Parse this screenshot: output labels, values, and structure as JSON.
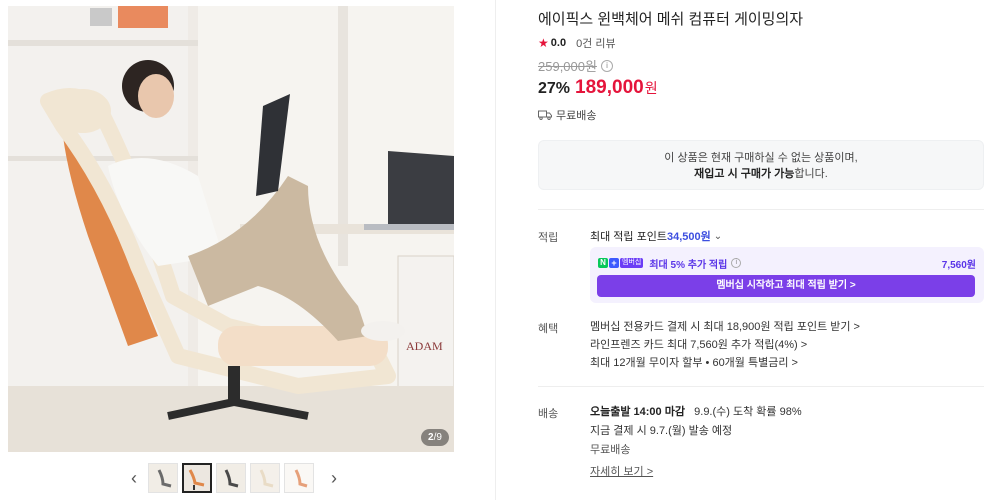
{
  "gallery": {
    "counter_current": "2",
    "counter_total": "/9",
    "prev_arrow": "‹",
    "next_arrow": "›"
  },
  "product": {
    "title": "에이픽스 윈백체어 메쉬 컴퓨터 게이밍의자",
    "rating": "0.0",
    "review_count": "0건 리뷰",
    "original_price": "259,000원",
    "discount": "27%",
    "price": "189,000",
    "price_unit": "원",
    "free_shipping": "무료배송"
  },
  "notice": {
    "line1": "이 상품은 현재 구매하실 수 없는 상품이며,",
    "line2_strong": "재입고 시 구매가 가능",
    "line2_rest": "합니다."
  },
  "points": {
    "label": "적립",
    "link_prefix": "최대 적립 포인트 ",
    "link_amount": "34,500원",
    "badge_n": "N",
    "badge_plus": "+",
    "badge_membership": "멤버십",
    "member_text": "최대 5% 추가 적립",
    "member_amount": "7,560원",
    "member_button": "멤버십 시작하고 최대 적립 받기 >"
  },
  "benefits": {
    "label": "혜택",
    "items": [
      "멤버십 전용카드 결제 시 최대 18,900원 적립 포인트 받기 >",
      "라인프렌즈 카드 최대 7,560원 추가 적립(4%) >",
      "최대 12개월 무이자 할부 • 60개월 특별금리 >"
    ]
  },
  "delivery": {
    "label": "배송",
    "cutoff": "오늘출발 14:00 마감",
    "arrival": "9.9.(수) 도착 확률 98%",
    "ship_date": "지금 결제 시 9.7.(월) 발송 예정",
    "fee": "무료배송",
    "detail_link": "자세히 보기 >"
  },
  "colors": {
    "price_red": "#e5143b",
    "points_blue": "#3d4fe0",
    "member_purple": "#7b3fe8",
    "member_bg": "#f4f1fe"
  },
  "icons": [
    "star-icon",
    "info-icon",
    "truck-icon",
    "chevron-down-icon",
    "chevron-left-icon",
    "chevron-right-icon"
  ]
}
